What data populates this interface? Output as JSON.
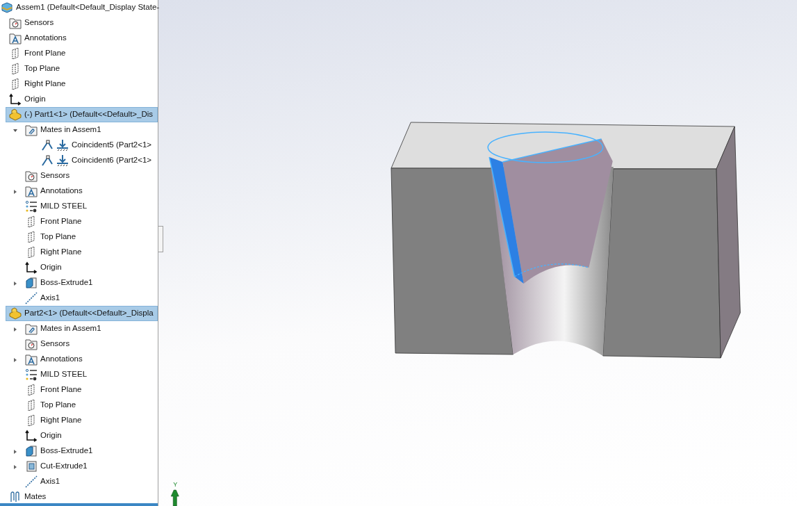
{
  "tree": {
    "label": "Assem1  (Default<Default_Display State-",
    "kind": "assembly",
    "selected": false,
    "children": [
      {
        "label": "Sensors",
        "kind": "sensors",
        "selected": false
      },
      {
        "label": "Annotations",
        "kind": "annotations",
        "selected": false
      },
      {
        "label": "Front Plane",
        "kind": "plane",
        "selected": false
      },
      {
        "label": "Top Plane",
        "kind": "plane",
        "selected": false
      },
      {
        "label": "Right Plane",
        "kind": "plane",
        "selected": false
      },
      {
        "label": "Origin",
        "kind": "origin",
        "selected": false
      },
      {
        "label": "(-) Part1<1> (Default<<Default>_Dis",
        "kind": "part",
        "selected": true,
        "children": [
          {
            "label": "Mates in Assem1",
            "kind": "mates-folder",
            "selected": false,
            "expanded": true,
            "children": [
              {
                "label": "Coincident5 (Part2<1>",
                "kind": "coincident",
                "selected": false
              },
              {
                "label": "Coincident6 (Part2<1>",
                "kind": "coincident",
                "selected": false
              }
            ]
          },
          {
            "label": "Sensors",
            "kind": "sensors",
            "selected": false
          },
          {
            "label": "Annotations",
            "kind": "annotations",
            "selected": false,
            "expanded": false
          },
          {
            "label": "MILD STEEL",
            "kind": "material",
            "selected": false
          },
          {
            "label": "Front Plane",
            "kind": "plane",
            "selected": false
          },
          {
            "label": "Top Plane",
            "kind": "plane",
            "selected": false
          },
          {
            "label": "Right Plane",
            "kind": "plane",
            "selected": false
          },
          {
            "label": "Origin",
            "kind": "origin",
            "selected": false
          },
          {
            "label": "Boss-Extrude1",
            "kind": "boss-extrude",
            "selected": false,
            "expanded": false
          },
          {
            "label": "Axis1",
            "kind": "axis",
            "selected": false
          }
        ]
      },
      {
        "label": "Part2<1> (Default<<Default>_Displa",
        "kind": "part",
        "selected": true,
        "children": [
          {
            "label": "Mates in Assem1",
            "kind": "mates-folder",
            "selected": false,
            "expanded": false
          },
          {
            "label": "Sensors",
            "kind": "sensors",
            "selected": false
          },
          {
            "label": "Annotations",
            "kind": "annotations",
            "selected": false,
            "expanded": false
          },
          {
            "label": "MILD STEEL",
            "kind": "material",
            "selected": false
          },
          {
            "label": "Front Plane",
            "kind": "plane",
            "selected": false
          },
          {
            "label": "Top Plane",
            "kind": "plane",
            "selected": false
          },
          {
            "label": "Right Plane",
            "kind": "plane",
            "selected": false
          },
          {
            "label": "Origin",
            "kind": "origin",
            "selected": false
          },
          {
            "label": "Boss-Extrude1",
            "kind": "boss-extrude",
            "selected": false,
            "expanded": false
          },
          {
            "label": "Cut-Extrude1",
            "kind": "cut-extrude",
            "selected": false,
            "expanded": false
          },
          {
            "label": "Axis1",
            "kind": "axis",
            "selected": false
          }
        ]
      },
      {
        "label": "Mates",
        "kind": "mates",
        "selected": false
      }
    ]
  },
  "triad": {
    "axis_label": "Y"
  }
}
